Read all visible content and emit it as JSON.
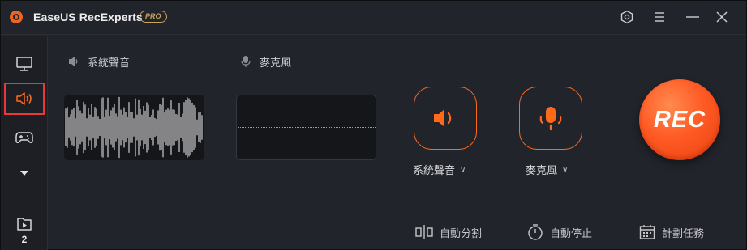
{
  "app": {
    "title": "EaseUS RecExperts",
    "badge": "PRO"
  },
  "titlebar": {
    "icons": [
      "settings-icon",
      "menu-icon",
      "minimize-icon",
      "close-icon"
    ]
  },
  "sidebar": {
    "items": [
      {
        "name": "screen",
        "icon": "monitor-icon"
      },
      {
        "name": "audio",
        "icon": "speaker-icon",
        "selected": true
      },
      {
        "name": "game",
        "icon": "gamepad-icon"
      },
      {
        "name": "more",
        "icon": "triangle-down-icon"
      }
    ],
    "recordings": {
      "icon": "video-folder-icon",
      "count": "2"
    }
  },
  "sources": {
    "system_sound": {
      "label": "系統聲音",
      "dropdown": "系統聲音",
      "icon": "speaker-icon"
    },
    "microphone": {
      "label": "麥克風",
      "dropdown": "麥克風",
      "icon": "microphone-icon"
    }
  },
  "rec": {
    "label": "REC"
  },
  "toolbar": {
    "auto_split": "自動分割",
    "auto_stop": "自動停止",
    "schedule": "計劃任務"
  },
  "colors": {
    "accent": "#ff6a1a",
    "rec": "#ff5a24",
    "selected_border": "#e8383b",
    "background": "#22242b"
  }
}
